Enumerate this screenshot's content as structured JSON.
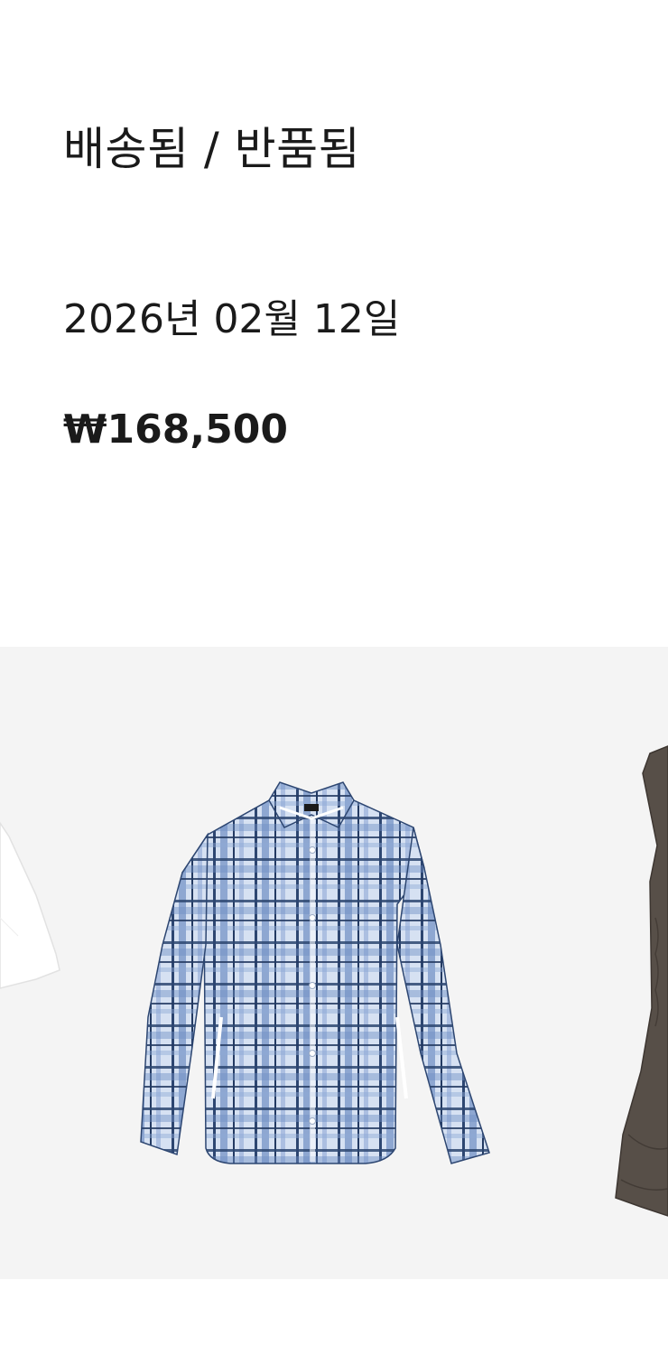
{
  "order": {
    "status": "배송됨 / 반품됨",
    "date": "2026년 02월 12일",
    "total": "₩168,500"
  },
  "carousel": {
    "items": [
      {
        "image": "white-top-cropped"
      },
      {
        "image": "blue-plaid-hooded-shirt"
      },
      {
        "image": "brown-ruched-dress-cropped"
      }
    ]
  }
}
